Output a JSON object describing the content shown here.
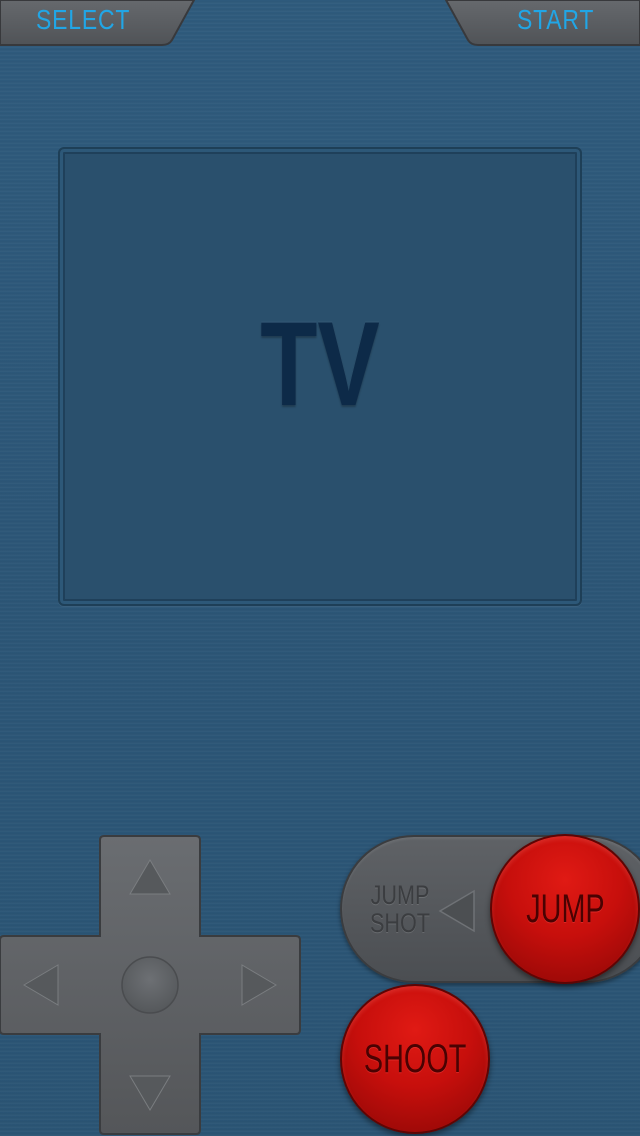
{
  "top_bar": {
    "select_label": "SELECT",
    "start_label": "START"
  },
  "tv": {
    "label": "TV"
  },
  "dpad": {
    "up_icon": "triangle-up",
    "down_icon": "triangle-down",
    "left_icon": "triangle-left",
    "right_icon": "triangle-right",
    "center_icon": "circle"
  },
  "slider": {
    "line1": "JUMP",
    "line2": "SHOT",
    "arrow_icon": "triangle-left"
  },
  "buttons": {
    "jump_label": "JUMP",
    "shoot_label": "SHOOT"
  },
  "colors": {
    "background": "#2c5677",
    "accent_text": "#21a6e6",
    "tv_text": "#0d2a48",
    "button_red": "#c70f0c",
    "control_gray": "#5f6266"
  }
}
